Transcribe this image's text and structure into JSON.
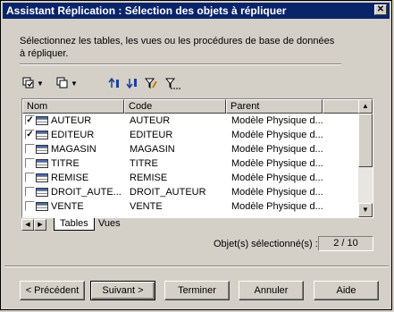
{
  "window": {
    "title": "Assistant Réplication : Sélection des objets à répliquer"
  },
  "instruction": "Sélectionnez les tables, les vues ou les procédures de base de données à répliquer.",
  "toolbar": {
    "icons": [
      "select-all-icon",
      "dropdown-arrow",
      "deselect-icon",
      "dropdown-arrow",
      "move-up-icon",
      "move-down-icon",
      "filter-edit-icon",
      "filter-clear-icon"
    ]
  },
  "grid": {
    "columns": [
      "Nom",
      "Code",
      "Parent"
    ],
    "rows": [
      {
        "checked": true,
        "nom": "AUTEUR",
        "code": "AUTEUR",
        "parent": "Modèle Physique d..."
      },
      {
        "checked": true,
        "nom": "EDITEUR",
        "code": "EDITEUR",
        "parent": "Modèle Physique d..."
      },
      {
        "checked": false,
        "nom": "MAGASIN",
        "code": "MAGASIN",
        "parent": "Modèle Physique d..."
      },
      {
        "checked": false,
        "nom": "TITRE",
        "code": "TITRE",
        "parent": "Modèle Physique d..."
      },
      {
        "checked": false,
        "nom": "REMISE",
        "code": "REMISE",
        "parent": "Modèle Physique d..."
      },
      {
        "checked": false,
        "nom": "DROIT_AUTE...",
        "code": "DROIT_AUTEUR",
        "parent": "Modèle Physique d..."
      },
      {
        "checked": false,
        "nom": "VENTE",
        "code": "VENTE",
        "parent": "Modèle Physique d..."
      }
    ]
  },
  "tabs": [
    "Tables",
    "Vues"
  ],
  "selection": {
    "label": "Objet(s) sélectionné(s) :",
    "value": "2 / 10"
  },
  "buttons": {
    "back": "< Précédent",
    "next": "Suivant >",
    "finish": "Terminer",
    "cancel": "Annuler",
    "help": "Aide"
  }
}
